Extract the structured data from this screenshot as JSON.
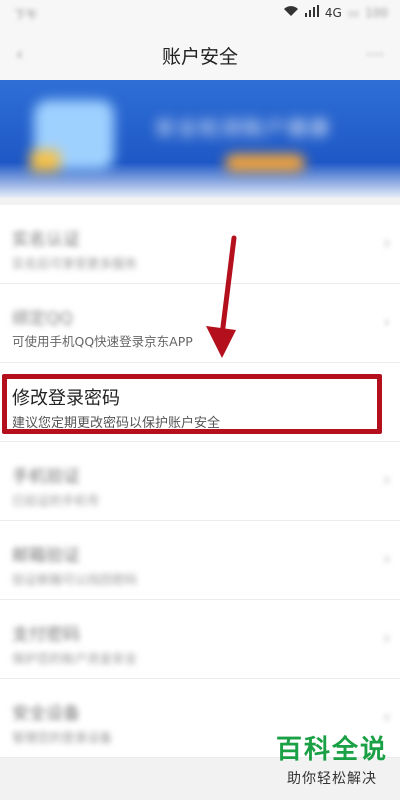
{
  "status_bar": {
    "time": "下午",
    "network": "4G",
    "battery": "100"
  },
  "nav": {
    "title": "账户安全"
  },
  "banner": {
    "text": "安全检测账户健康"
  },
  "rows": [
    {
      "title": "实名认证",
      "sub": "实名后可享受更多服务",
      "blurred": true
    },
    {
      "title": "绑定QQ",
      "sub_visible": "可使用手机QQ快速登录京东APP",
      "sub_hidden_prefix": "",
      "blurred_title": true
    },
    {
      "title": "修改登录密码",
      "sub": "建议您定期更改密码以保护账户安全",
      "highlighted": true
    },
    {
      "title": "手机验证",
      "sub": "已验证的手机号",
      "blurred": true
    },
    {
      "title": "邮箱验证",
      "sub": "验证邮箱可以找回密码",
      "blurred": true
    },
    {
      "title": "支付密码",
      "sub": "保护您的账户资金安全",
      "blurred": true
    },
    {
      "title": "安全设备",
      "sub": "管理您的登录设备",
      "blurred": true
    }
  ],
  "colors": {
    "highlight_border": "#b30f1c",
    "watermark_green": "#1aa045",
    "banner_blue": "#2f6fd6"
  },
  "watermark": {
    "main": "百科全说",
    "sub": "助你轻松解决"
  }
}
